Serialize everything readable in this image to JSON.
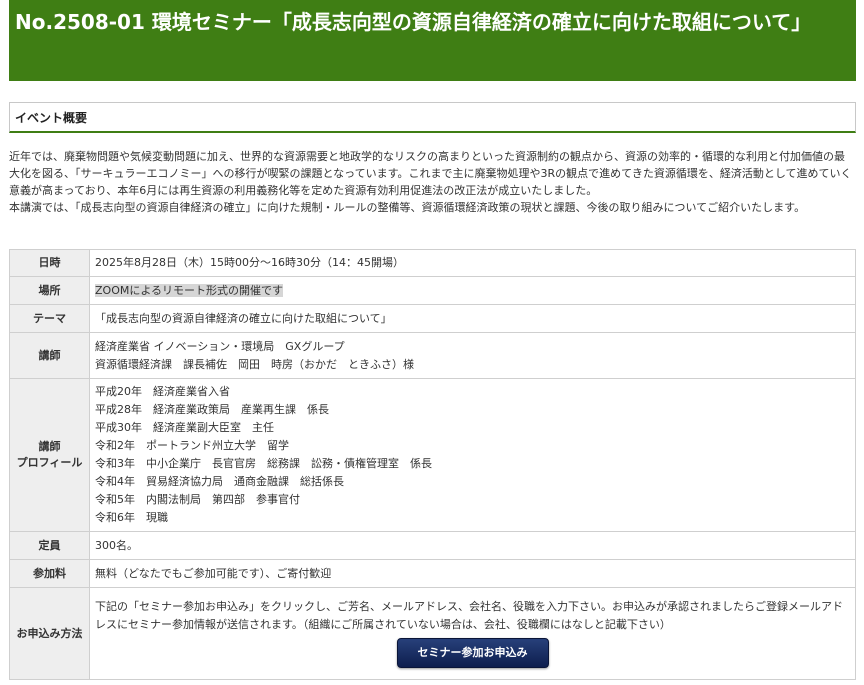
{
  "header": {
    "title": "No.2508-01 環境セミナー「成長志向型の資源自律経済の確立に向けた取組について」"
  },
  "overview": {
    "heading": "イベント概要",
    "paragraphs": [
      "近年では、廃棄物問題や気候変動問題に加え、世界的な資源需要と地政学的なリスクの高まりといった資源制約の観点から、資源の効率的・循環的な利用と付加価値の最大化を図る、「サーキュラーエコノミー」への移行が喫緊の課題となっています。これまで主に廃棄物処理や3Rの観点で進めてきた資源循環を、経済活動として進めていく意義が高まっており、本年6月には再生資源の利用義務化等を定めた資源有効利用促進法の改正法が成立いたしました。",
      "本講演では、「成長志向型の資源自律経済の確立」に向けた規制・ルールの整備等、資源循環経済政策の現状と課題、今後の取り組みについてご紹介いたします。"
    ]
  },
  "details": {
    "date_label": "日時",
    "date_value": "2025年8月28日（木）15時00分～16時30分（14：45開場）",
    "place_label": "場所",
    "place_value": "ZOOMによるリモート形式の開催です",
    "theme_label": "テーマ",
    "theme_value": "「成長志向型の資源自律経済の確立に向けた取組について」",
    "speaker_label": "講師",
    "speaker_lines": [
      "経済産業省 イノベーション・環境局　GXグループ",
      "資源循環経済課　課長補佐　岡田　時房（おかだ　ときふさ）様"
    ],
    "profile_label_1": "講師",
    "profile_label_2": "プロフィール",
    "profile_lines": [
      "平成20年　経済産業省入省",
      "平成28年　経済産業政策局　産業再生課　係長",
      "平成30年　経済産業副大臣室　主任",
      "令和2年　ポートランド州立大学　留学",
      "令和3年　中小企業庁　長官官房　総務課　訟務・債権管理室　係長",
      "令和4年　貿易経済協力局　通商金融課　総括係長",
      "令和5年　内閣法制局　第四部　参事官付",
      "令和6年　現職"
    ],
    "capacity_label": "定員",
    "capacity_value": "300名。",
    "fee_label": "参加料",
    "fee_value": "無料（どなたでもご参加可能です）、ご寄付歓迎",
    "apply_label": "お申込み方法",
    "apply_text": "下記の「セミナー参加お申込み」をクリックし、ご芳名、メールアドレス、会社名、役職を入力下さい。お申込みが承認されましたらご登録メールアドレスにセミナー参加情報が送信されます。（組織にご所属されていない場合は、会社、役職欄にはなしと記載下さい）",
    "apply_button": "セミナー参加お申込み"
  }
}
